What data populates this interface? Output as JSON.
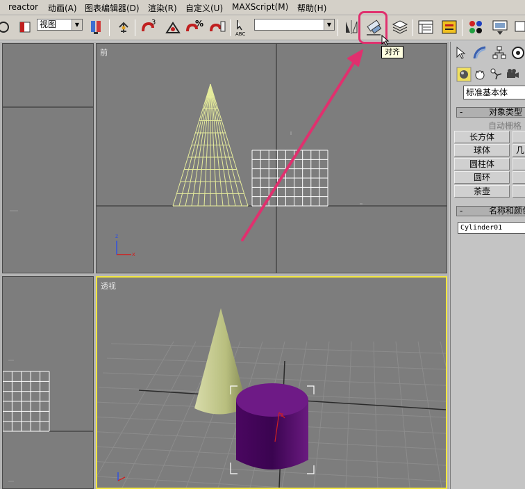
{
  "menu": {
    "items": [
      "reactor",
      "动画(A)",
      "图表编辑器(D)",
      "渲染(R)",
      "自定义(U)",
      "MAXScript(M)",
      "帮助(H)"
    ]
  },
  "toolbar": {
    "view_combo": "视图",
    "selection_set_combo": "",
    "snap_angle_label": "3",
    "percent_snap_label": "%",
    "spinner_snap_label": "",
    "abc_label": "ABC",
    "align_tooltip": "对齐",
    "icons": [
      "select-region-icon",
      "reference-coord-icon",
      "pivot-icon",
      "select-move-icon",
      "snap-3-icon",
      "angle-snap-icon",
      "percent-snap-icon",
      "spinner-snap-icon",
      "named-selection-icon",
      "mirror-icon",
      "align-icon",
      "layers-icon",
      "track-view-icon",
      "schematic-view-icon",
      "material-editor-icon",
      "render-scene-icon",
      "quick-render-icon"
    ]
  },
  "viewports": {
    "front_label": "前",
    "perspective_label": "透视",
    "axis_x": "x",
    "axis_z": "z"
  },
  "command_panel": {
    "tabs": [
      "create-tab-icon",
      "modify-tab-icon",
      "hierarchy-tab-icon",
      "motion-tab-icon"
    ],
    "sub_tabs": [
      "geometry-icon",
      "shapes-icon",
      "lights-icon",
      "cameras-icon"
    ],
    "category": "标准基本体",
    "object_type_title": "对象类型",
    "auto_grid": "自动栅格",
    "buttons": [
      "长方体",
      "球体",
      "圆柱体",
      "圆环",
      "茶壶"
    ],
    "buttons_right": [
      "",
      "几",
      "",
      "",
      ""
    ],
    "name_color_title": "名称和颜色",
    "object_name": "Cylinder01"
  },
  "colors": {
    "highlight": "#e0306e",
    "active_viewport": "#f2e640",
    "cone_wire": "#e6ec9c",
    "cylinder": "#5a0a6e"
  }
}
